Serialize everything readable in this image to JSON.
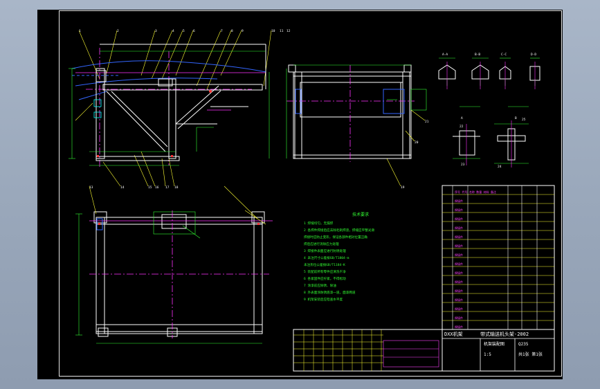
{
  "drawing": {
    "section_labels": [
      "A-A",
      "B-B",
      "C-C",
      "D-D"
    ],
    "detail_labels": [
      "A",
      "B"
    ],
    "item_numbers_top": [
      "1",
      "2",
      "3",
      "4",
      "5",
      "6",
      "7",
      "8",
      "9",
      "10",
      "11",
      "12"
    ],
    "item_numbers_bottom": [
      "13",
      "14",
      "15",
      "16",
      "17",
      "18"
    ],
    "item_numbers_right": [
      "19",
      "20",
      "21",
      "22",
      "23",
      "24",
      "25"
    ],
    "notes_title": "技术要求",
    "notes": [
      "1  焊缝均匀，无漏焊",
      "2  各焊件焊接后应去除毛刺焊渣，焊缝应平整光滑",
      "   焊接时应防止变形，保证各部件相对位置正确",
      "   焊后应进行消除应力处理",
      "3  焊接件表面应进行防锈处理",
      "4  未注尺寸公差按GB/T1804-m",
      "   未注形位公差按GB/T1184-K",
      "5  装配前所有零件应清洗干净",
      "6  各紧固件应拧紧，不得松动",
      "7  涂漆前应除锈、除油",
      "8  外表面涂防锈底漆一道，面漆两道",
      "9  机架安装后应检查水平度"
    ]
  },
  "title_block": {
    "unit": "DXX机架",
    "drawing_no": "带式输送机头架-2002",
    "part_name": "机架装配图",
    "scale": "1:5",
    "material": "Q235",
    "sheet": "共1张 第1张",
    "rows": [
      "序号  代号  名称  数量  材料  备注",
      "焊接件",
      "焊接件",
      "焊接件",
      "焊接件",
      "焊接件",
      "焊接件",
      "焊接件",
      "焊接件",
      "焊接件",
      "焊接件",
      "焊接件",
      "焊接件",
      "焊接件",
      "焊接件",
      "焊接件"
    ]
  },
  "colors": {
    "outline": "#ffffff",
    "centerline": "#ff33ff",
    "dimension": "#33ff33",
    "hidden": "#3366ff",
    "annotation": "#ffff33",
    "part": "#00ffff",
    "section": "#ff3333"
  }
}
